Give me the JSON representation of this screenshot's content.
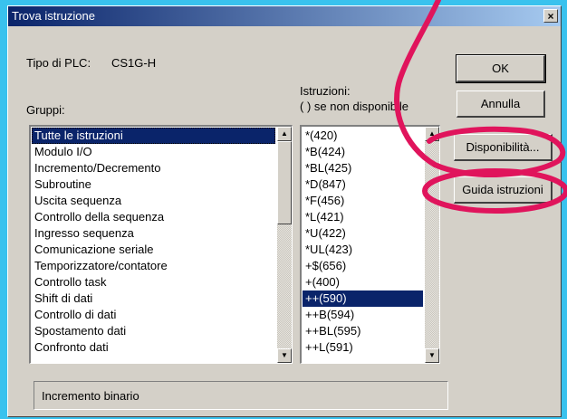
{
  "window": {
    "title": "Trova istruzione",
    "close_symbol": "×"
  },
  "plc": {
    "label": "Tipo di PLC:",
    "value": "CS1G-H"
  },
  "groups": {
    "label": "Gruppi:",
    "items": [
      "Tutte le istruzioni",
      "Modulo I/O",
      "Incremento/Decremento",
      "Subroutine",
      "Uscita sequenza",
      "Controllo della sequenza",
      "Ingresso sequenza",
      "Comunicazione seriale",
      "Temporizzatore/contatore",
      "Controllo task",
      "Shift di dati",
      "Controllo di dati",
      "Spostamento dati",
      "Confronto dati"
    ],
    "selected_index": 0,
    "scroll_position": 0.0
  },
  "instructions": {
    "label_line1": "Istruzioni:",
    "label_line2": "( ) se non disponibile",
    "items": [
      "*(420)",
      "*B(424)",
      "*BL(425)",
      "*D(847)",
      "*F(456)",
      "*L(421)",
      "*U(422)",
      "*UL(423)",
      "+$(656)",
      "+(400)",
      "++(590)",
      "++B(594)",
      "++BL(595)",
      "++L(591)"
    ],
    "selected_index": 10
  },
  "buttons": {
    "ok": "OK",
    "cancel": "Annulla",
    "availability": "Disponibilità...",
    "guide": "Guida istruzioni"
  },
  "status": {
    "description": "Incremento binario"
  },
  "icons": {
    "scroll_up": "▲",
    "scroll_down": "▼"
  },
  "colors": {
    "background": "#39c2ee",
    "dialog": "#d4d0c8",
    "selection": "#0a246a",
    "annotation": "#e0145c"
  }
}
